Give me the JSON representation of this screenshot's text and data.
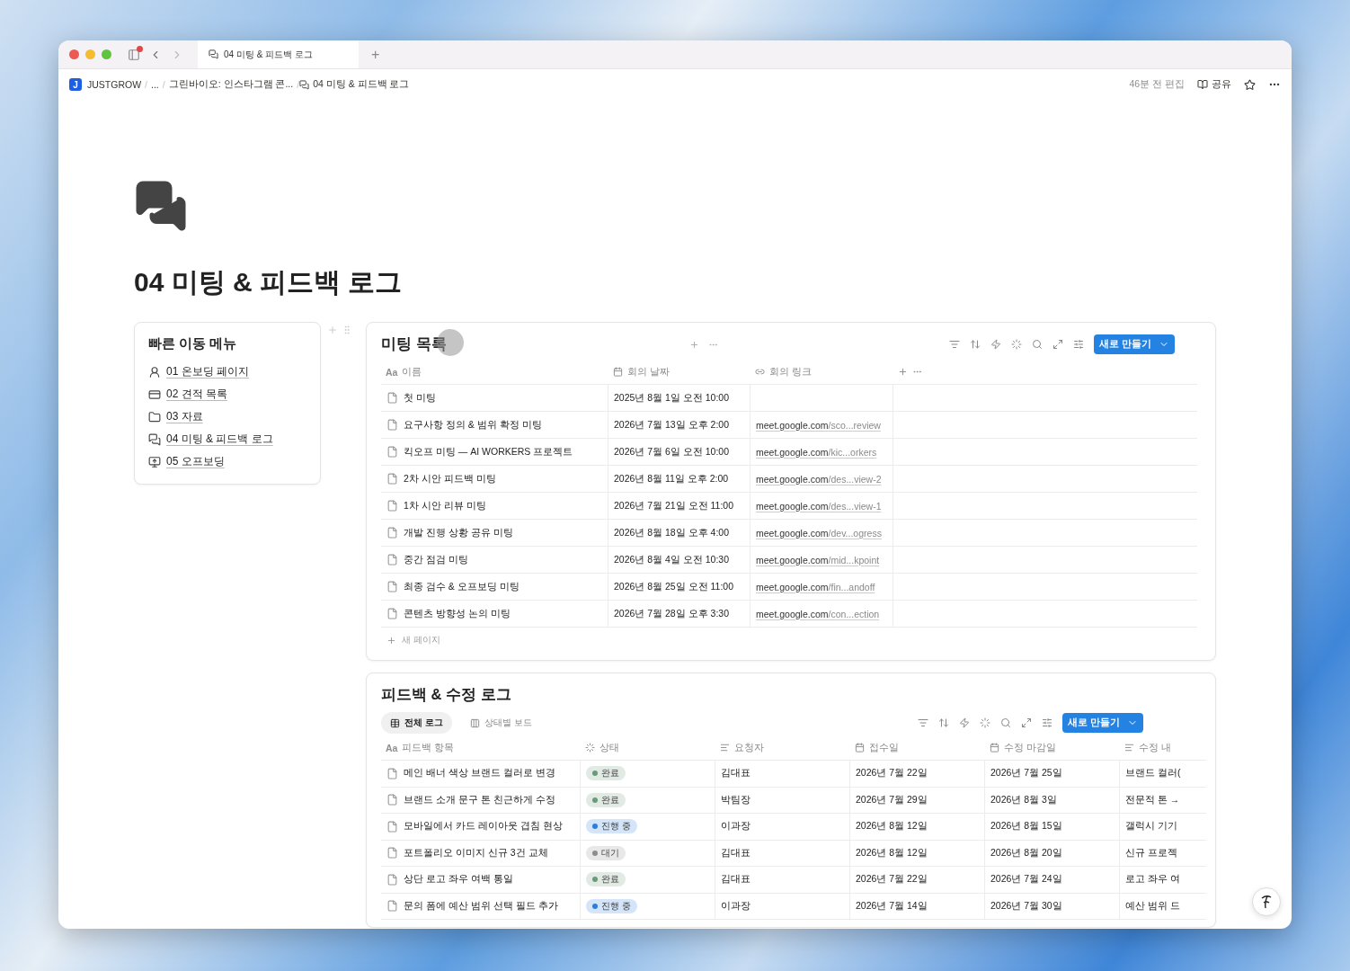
{
  "browser": {
    "tab_title": "04 미팅 & 피드백 로그",
    "new_tab": "+"
  },
  "breadcrumb": {
    "logo": "J",
    "separator": "/",
    "items": [
      "JUSTGROW",
      "...",
      "그린바이오: 인스타그램 콘...",
      "04 미팅 & 피드백 로그"
    ]
  },
  "topbar": {
    "edited": "46분 전 편집",
    "share": "공유"
  },
  "page": {
    "title": "04 미팅 & 피드백 로그"
  },
  "quick_menu": {
    "title": "빠른 이동 메뉴",
    "items": [
      {
        "label": "01 온보딩 페이지",
        "kind": "user"
      },
      {
        "label": "02 견적 목록",
        "kind": "card"
      },
      {
        "label": "03 자료",
        "kind": "folder"
      },
      {
        "label": "04 미팅 & 피드백 로그",
        "kind": "chat"
      },
      {
        "label": "05 오프보딩",
        "kind": "monitor"
      }
    ]
  },
  "meetings": {
    "title": "미팅 목록",
    "new_button": "새로 만들기",
    "new_page": "새 페이지",
    "columns": [
      {
        "label": "이름",
        "kind": "title",
        "icon_text": "Aa"
      },
      {
        "label": "회의 날짜",
        "kind": "date"
      },
      {
        "label": "회의 링크",
        "kind": "url"
      }
    ],
    "rows": [
      {
        "name": "첫 미팅",
        "date": "2025년 8월 1일 오전 10:00"
      },
      {
        "name": "요구사항 정의 & 범위 확정 미팅",
        "date": "2026년 7월 13일 오후 2:00",
        "link": {
          "host": "meet.google.com",
          "path": "/sco...review"
        }
      },
      {
        "name": "킥오프 미팅 — AI WORKERS 프로젝트",
        "date": "2026년 7월 6일 오전 10:00",
        "link": {
          "host": "meet.google.com",
          "path": "/kic...orkers"
        }
      },
      {
        "name": "2차 시안 피드백 미팅",
        "date": "2026년 8월 11일 오후 2:00",
        "link": {
          "host": "meet.google.com",
          "path": "/des...view-2"
        }
      },
      {
        "name": "1차 시안 리뷰 미팅",
        "date": "2026년 7월 21일 오전 11:00",
        "link": {
          "host": "meet.google.com",
          "path": "/des...view-1"
        }
      },
      {
        "name": "개발 진행 상황 공유 미팅",
        "date": "2026년 8월 18일 오후 4:00",
        "link": {
          "host": "meet.google.com",
          "path": "/dev...ogress"
        }
      },
      {
        "name": "중간 점검 미팅",
        "date": "2026년 8월 4일 오전 10:30",
        "link": {
          "host": "meet.google.com",
          "path": "/mid...kpoint"
        }
      },
      {
        "name": "최종 검수 & 오프보딩 미팅",
        "date": "2026년 8월 25일 오전 11:00",
        "link": {
          "host": "meet.google.com",
          "path": "/fin...andoff"
        }
      },
      {
        "name": "콘텐츠 방향성 논의 미팅",
        "date": "2026년 7월 28일 오후 3:30",
        "link": {
          "host": "meet.google.com",
          "path": "/con...ection"
        }
      }
    ]
  },
  "feedback": {
    "title": "피드백 & 수정 로그",
    "new_button": "새로 만들기",
    "views": [
      {
        "label": "전체 로그",
        "kind": "table",
        "selected": true
      },
      {
        "label": "상태별 보드",
        "kind": "board",
        "selected": false
      }
    ],
    "columns": [
      {
        "label": "피드백 항목",
        "kind": "title",
        "icon_text": "Aa"
      },
      {
        "label": "상태",
        "kind": "status"
      },
      {
        "label": "요청자",
        "kind": "text"
      },
      {
        "label": "접수일",
        "kind": "date"
      },
      {
        "label": "수정 마감일",
        "kind": "date"
      },
      {
        "label": "수정 내",
        "kind": "text"
      }
    ],
    "rows": [
      {
        "item": "메인 배너 색상 브랜드 컬러로 변경",
        "status": {
          "label": "완료",
          "color": "#6b9a7a"
        },
        "requester": "김대표",
        "received": "2026년 7월 22일",
        "deadline": "2026년 7월 25일",
        "content": "브랜드 컬러("
      },
      {
        "item": "브랜드 소개 문구 톤 친근하게 수정",
        "status": {
          "label": "완료",
          "color": "#6b9a7a"
        },
        "requester": "박팀장",
        "received": "2026년 7월 29일",
        "deadline": "2026년 8월 3일",
        "content": "전문적 톤 →"
      },
      {
        "item": "모바일에서 카드 레이아웃 겹침 현상",
        "status": {
          "label": "진행 중",
          "color": "#2b7de0"
        },
        "requester": "이과장",
        "received": "2026년 8월 12일",
        "deadline": "2026년 8월 15일",
        "content": "갤럭시 기기"
      },
      {
        "item": "포트폴리오 이미지 신규 3건 교체",
        "status": {
          "label": "대기",
          "color": "#8c8c8c"
        },
        "requester": "김대표",
        "received": "2026년 8월 12일",
        "deadline": "2026년 8월 20일",
        "content": "신규 프로젝"
      },
      {
        "item": "상단 로고 좌우 여백 통일",
        "status": {
          "label": "완료",
          "color": "#6b9a7a"
        },
        "requester": "김대표",
        "received": "2026년 7월 22일",
        "deadline": "2026년 7월 24일",
        "content": "로고 좌우 여"
      },
      {
        "item": "문의 폼에 예산 범위 선택 필드 추가",
        "status": {
          "label": "진행 중",
          "color": "#2b7de0"
        },
        "requester": "이과장",
        "received": "2026년 7월 14일",
        "deadline": "2026년 7월 30일",
        "content": "예산 범위 드"
      }
    ]
  }
}
